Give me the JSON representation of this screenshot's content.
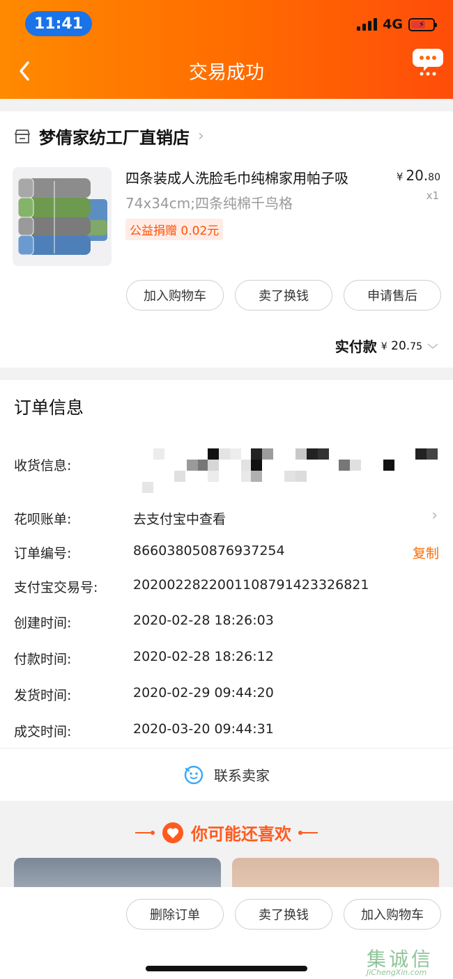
{
  "status": {
    "time": "11:41",
    "network": "4G"
  },
  "nav": {
    "title": "交易成功"
  },
  "store": {
    "name": "梦倩家纺工厂直销店"
  },
  "product": {
    "title": "四条装成人洗脸毛巾纯棉家用帕子吸",
    "spec": "74x34cm;四条纯棉千鸟格",
    "badge": "公益捐赠 0.02元",
    "price_symbol": "¥",
    "price_int": "20.",
    "price_dec": "80",
    "qty": "x1"
  },
  "actions": {
    "add_cart": "加入购物车",
    "resell": "卖了换钱",
    "after_sale": "申请售后"
  },
  "paid": {
    "label": "实付款",
    "symbol": "¥",
    "int": "20.",
    "dec": "75"
  },
  "order_info": {
    "title": "订单信息",
    "receive_label": "收货信息:",
    "huabei_label": "花呗账单:",
    "huabei_value": "去支付宝中查看",
    "order_no_label": "订单编号:",
    "order_no": "866038050876937254",
    "copy": "复制",
    "alipay_label": "支付宝交易号:",
    "alipay_no": "2020022822001108791423326821",
    "created_label": "创建时间:",
    "created": "2020-02-28 18:26:03",
    "paid_label": "付款时间:",
    "paid_time": "2020-02-28 18:26:12",
    "shipped_label": "发货时间:",
    "shipped": "2020-02-29 09:44:20",
    "done_label": "成交时间:",
    "done": "2020-03-20 09:44:31"
  },
  "contact": {
    "label": "联系卖家"
  },
  "recommend": {
    "title": "你可能还喜欢"
  },
  "bottom": {
    "delete": "删除订单",
    "resell": "卖了换钱",
    "add_cart": "加入购物车"
  },
  "watermark": {
    "main": "集诚信",
    "sub": "JiChengXin.com"
  },
  "colors": {
    "brand_orange": "#ff6a00",
    "badge_bg": "#ffece6",
    "time_pill": "#1a73e8"
  }
}
